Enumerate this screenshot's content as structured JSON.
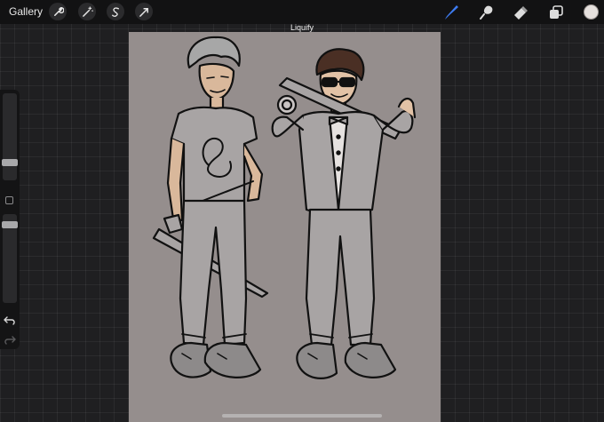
{
  "topbar": {
    "gallery_label": "Gallery",
    "tools_left": [
      "wrench-icon",
      "magic-wand-icon",
      "selection-s-icon",
      "transform-arrow-icon"
    ],
    "tools_right": [
      "brush-icon",
      "smudge-icon",
      "eraser-icon",
      "layers-icon"
    ],
    "active_tool_color": "#3d7bf0",
    "current_color": "#e6e1de"
  },
  "mode": {
    "label": "Liquify"
  },
  "canvas": {
    "background": "#958e8d"
  },
  "sidebar": {
    "brush_size_level": 0.28,
    "opacity_level": 0.34,
    "buttons": [
      "modify-square-icon",
      "undo-icon",
      "redo-icon"
    ]
  }
}
